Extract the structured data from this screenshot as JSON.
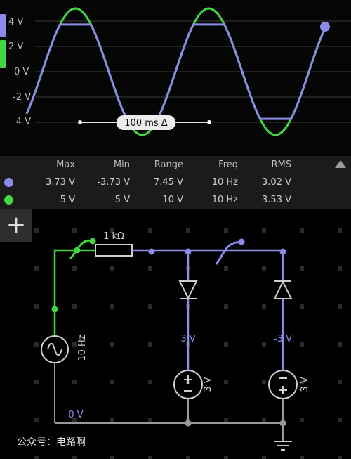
{
  "scope": {
    "y_axis_labels": [
      "4 V",
      "2 V",
      "0 V",
      "-2 V",
      "-4 V"
    ],
    "time_marker_label": "100 ms Δ",
    "colors": {
      "blue_trace": "#8b8be8",
      "green_trace": "#42d642",
      "grid": "#3a3a3a"
    }
  },
  "table": {
    "headers": [
      "Max",
      "Min",
      "Range",
      "Freq",
      "RMS"
    ],
    "rows": [
      {
        "color": "#8b8be8",
        "values": [
          "3.73 V",
          "-3.73 V",
          "7.45 V",
          "10 Hz",
          "3.02 V"
        ]
      },
      {
        "color": "#42d642",
        "values": [
          "5 V",
          "-5 V",
          "10 V",
          "10 Hz",
          "3.53 V"
        ]
      }
    ],
    "collapse_icon": "triangle-up-icon"
  },
  "toolbar": {
    "add_label": "+"
  },
  "circuit": {
    "resistor_label": "1 kΩ",
    "source_freq_label": "10 Hz",
    "battery_left_label": "3 V",
    "battery_right_label": "3 V",
    "voltage_left_label": "3 V",
    "voltage_right_label": "-3 V",
    "ground_label": "0 V"
  },
  "watermark": "公众号：电路啊"
}
